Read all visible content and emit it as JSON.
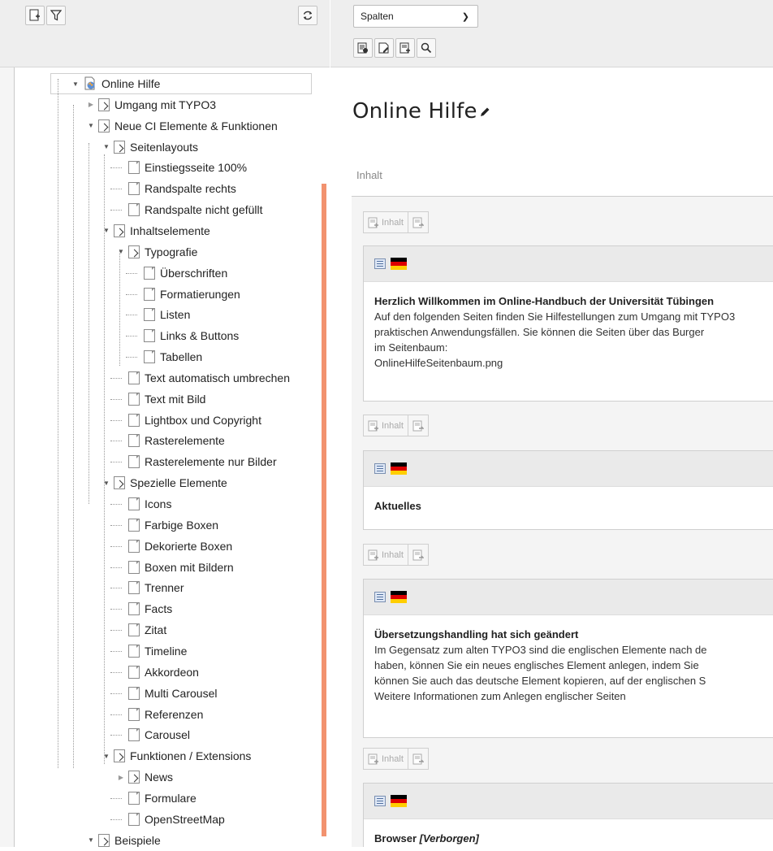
{
  "tree_toolbar": {
    "new_page_label": "New page",
    "filter_label": "Filter",
    "refresh_label": "Refresh"
  },
  "content_toolbar": {
    "view_select": "Spalten"
  },
  "tree": {
    "root": "Online Hilfe",
    "items": [
      "Umgang mit TYPO3",
      "Neue CI Elemente & Funktionen",
      "Seitenlayouts",
      "Einstiegsseite 100%",
      "Randspalte rechts",
      "Randspalte nicht gefüllt",
      "Inhaltselemente",
      "Typografie",
      "Überschriften",
      "Formatierungen",
      "Listen",
      "Links & Buttons",
      "Tabellen",
      "Text automatisch umbrechen",
      "Text mit Bild",
      "Lightbox und Copyright",
      "Rasterelemente",
      "Rasterelemente nur Bilder",
      "Spezielle Elemente",
      "Icons",
      "Farbige Boxen",
      "Dekorierte Boxen",
      "Boxen mit Bildern",
      "Trenner",
      "Facts",
      "Zitat",
      "Timeline",
      "Akkordeon",
      "Multi Carousel",
      "Referenzen",
      "Carousel",
      "Funktionen / Extensions",
      "News",
      "Formulare",
      "OpenStreetMap",
      "Beispiele"
    ]
  },
  "content": {
    "page_title": "Online Hilfe",
    "column_header": "Inhalt",
    "add_content_label": "Inhalt",
    "flag_colors": [
      "#000000",
      "#dd0000",
      "#ffce00"
    ],
    "elements": [
      {
        "heading": "Herzlich Willkommen im Online-Handbuch der Universität Tübingen",
        "lines": [
          "Auf den folgenden Seiten finden Sie Hilfestellungen zum Umgang mit TYPO3",
          "praktischen Anwendungsfällen. Sie können die Seiten über das Burger",
          "im Seitenbaum:",
          "OnlineHilfeSeitenbaum.png"
        ]
      },
      {
        "heading": "Aktuelles",
        "lines": []
      },
      {
        "heading": "Übersetzungshandling hat sich geändert",
        "lines": [
          "Im Gegensatz zum alten TYPO3 sind die englischen Elemente nach de",
          "haben, können Sie ein neues englisches Element anlegen, indem Sie",
          "können Sie auch das deutsche Element kopieren, auf der englischen S",
          "Weitere Informationen zum Anlegen englischer Seiten"
        ]
      },
      {
        "heading": "Browser",
        "heading_suffix": "[Verborgen]",
        "lines": []
      }
    ]
  }
}
